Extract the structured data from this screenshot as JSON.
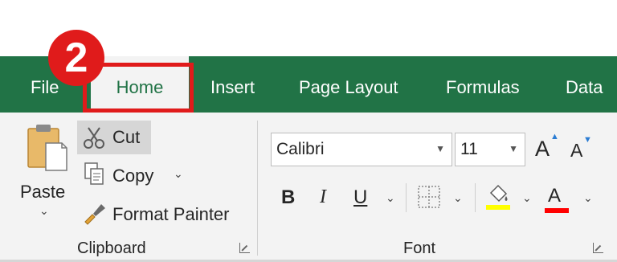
{
  "tabs": [
    {
      "label": "File"
    },
    {
      "label": "Home"
    },
    {
      "label": "Insert"
    },
    {
      "label": "Page Layout"
    },
    {
      "label": "Formulas"
    },
    {
      "label": "Data"
    }
  ],
  "annotation": {
    "step_number": "2"
  },
  "clipboard": {
    "paste_label": "Paste",
    "paste_chevron": "⌄",
    "cut_label": "Cut",
    "copy_label": "Copy",
    "copy_chevron": "⌄",
    "format_painter_label": "Format Painter",
    "group_label": "Clipboard"
  },
  "font": {
    "font_name": "Calibri",
    "font_size": "11",
    "grow_label": "A",
    "shrink_label": "A",
    "bold_label": "B",
    "italic_label": "I",
    "underline_label": "U",
    "font_color_label": "A",
    "group_label": "Font"
  },
  "colors": {
    "ribbon_green": "#217346",
    "highlight_red": "#e01b1b",
    "fill_yellow": "#ffff00",
    "font_red": "#ff0000"
  },
  "icons": {
    "paste": "clipboard-icon",
    "cut": "scissors-icon",
    "copy": "copy-icon",
    "format_painter": "paintbrush-icon",
    "borders": "borders-icon",
    "fill": "paint-bucket-icon",
    "launcher": "dialog-launcher-icon"
  }
}
